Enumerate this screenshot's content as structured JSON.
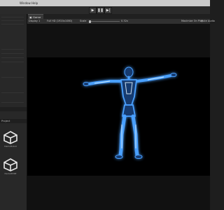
{
  "menubar": {
    "items": [
      "Window",
      "Help"
    ]
  },
  "toolbar": {
    "play_icon": "play-icon",
    "pause_icon": "pause-icon",
    "step_icon": "step-icon"
  },
  "left_panel": {
    "console_tab": "Console",
    "project_tab": "Project",
    "assets": [
      {
        "label": "DemoRobot",
        "icon": "unity-logo-icon"
      },
      {
        "label": "DemoPOSE",
        "icon": "unity-logo-icon"
      }
    ]
  },
  "game_view": {
    "tab_label": "Game",
    "display": "Display 1",
    "resolution": "Full HD (1920x1080)",
    "scale_label": "Scale",
    "scale_value": "0.32x",
    "maximize_label": "Maximize On Play",
    "mute_label": "Mute Audio"
  },
  "colors": {
    "glow": "#4aa0ff",
    "core": "#dff2ff",
    "background": "#000000"
  }
}
